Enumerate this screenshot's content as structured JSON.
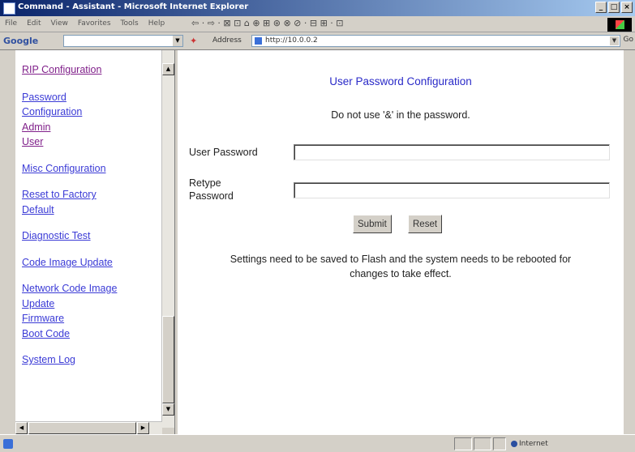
{
  "window": {
    "title": "Command - Assistant - Microsoft Internet Explorer"
  },
  "menubar": {
    "items": [
      "File",
      "Edit",
      "View",
      "Favorites",
      "Tools",
      "Help"
    ]
  },
  "toolbar": {
    "glyphs": "⇦ · ⇨ · ⊠ ⊡ ⌂ ⊕ ⊞ ⊛ ⊗ ⊘ · ⊟ ⊞ · ⊡"
  },
  "googlebar": {
    "label": "Google"
  },
  "addressbar": {
    "label": "Address",
    "url": "http://10.0.0.2",
    "go_label": "Go"
  },
  "sidebar": {
    "links": [
      {
        "label": "RIP Configuration",
        "visited": true
      },
      {
        "label": "Password",
        "visited": false
      },
      {
        "label": "Configuration",
        "visited": false
      },
      {
        "label": "Admin",
        "visited": true
      },
      {
        "label": "User",
        "visited": true
      },
      {
        "label": "Misc Configuration",
        "visited": false
      },
      {
        "label": "Reset to Factory",
        "visited": false
      },
      {
        "label": "Default",
        "visited": false
      },
      {
        "label": "Diagnostic Test",
        "visited": false
      },
      {
        "label": "Code Image Update",
        "visited": false
      },
      {
        "label": "Network Code Image",
        "visited": false
      },
      {
        "label": "Update",
        "visited": false
      },
      {
        "label": "Firmware",
        "visited": false
      },
      {
        "label": "Boot Code",
        "visited": false
      },
      {
        "label": "System Log",
        "visited": false
      }
    ]
  },
  "main": {
    "title": "User Password Configuration",
    "note": "Do not use '&' in the password.",
    "user_password_label": "User Password",
    "retype_label_line1": "Retype",
    "retype_label_line2": "Password",
    "user_password_value": "",
    "retype_password_value": "",
    "submit_label": "Submit",
    "reset_label": "Reset",
    "info_line1": "Settings need to be saved to Flash and the system needs to be rebooted for",
    "info_line2": "changes to take effect."
  },
  "statusbar": {
    "zone": "Internet"
  },
  "colors": {
    "link": "#3b3bd6",
    "visited_link": "#80208a",
    "title": "#2a2ac8",
    "chrome": "#d4d0c8"
  }
}
